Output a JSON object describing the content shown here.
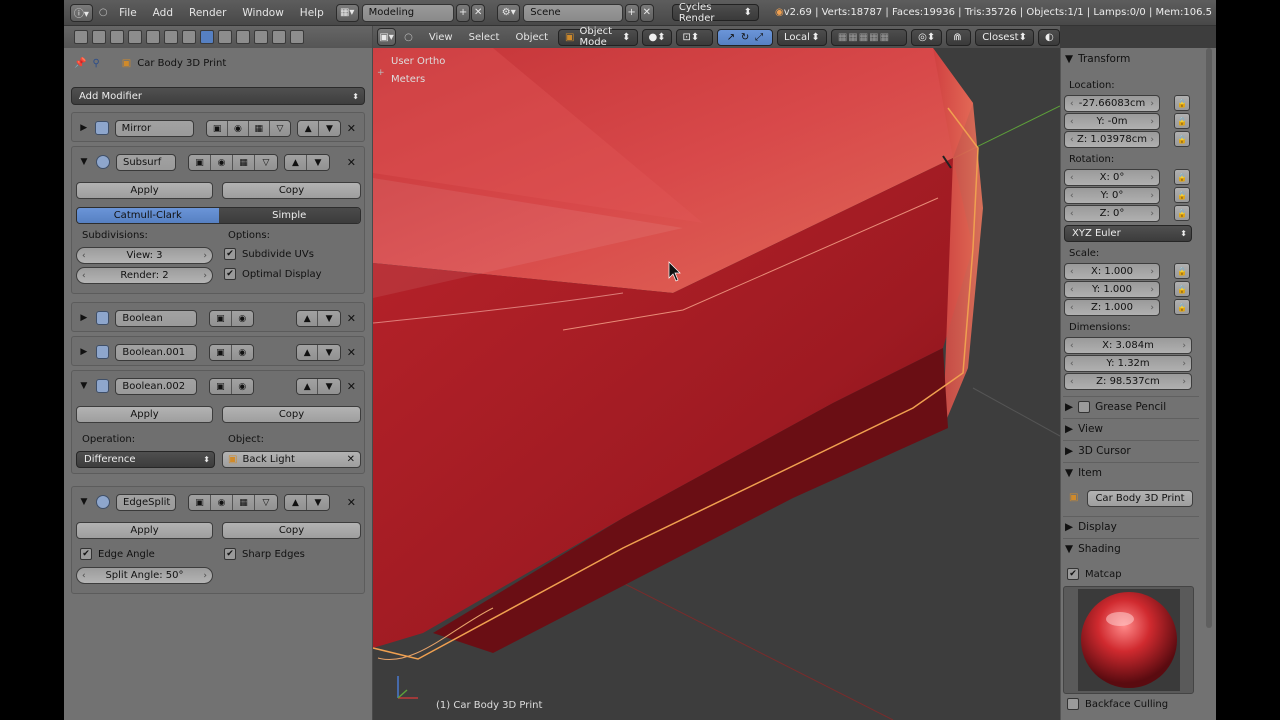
{
  "info_header": {
    "menus": [
      "File",
      "Add",
      "Render",
      "Window",
      "Help"
    ],
    "screen_layout": "Modeling",
    "scene": "Scene",
    "engine": "Cycles Render",
    "stats": "v2.69 | Verts:18787 | Faces:19936 | Tris:35726 | Objects:1/1 | Lamps:0/0 | Mem:106.5"
  },
  "props": {
    "object_name": "Car Body 3D Print",
    "add_modifier": "Add Modifier",
    "apply": "Apply",
    "copy": "Copy",
    "mirror": {
      "name": "Mirror"
    },
    "subsurf": {
      "name": "Subsurf",
      "mode_a": "Catmull-Clark",
      "mode_b": "Simple",
      "subdivisions_label": "Subdivisions:",
      "options_label": "Options:",
      "view": "View: 3",
      "render": "Render: 2",
      "subdivide_uvs": "Subdivide UVs",
      "optimal_display": "Optimal Display"
    },
    "boolean": {
      "name": "Boolean"
    },
    "boolean001": {
      "name": "Boolean.001"
    },
    "boolean002": {
      "name": "Boolean.002",
      "operation_label": "Operation:",
      "object_label": "Object:",
      "operation": "Difference",
      "object": "Back Light"
    },
    "edgesplit": {
      "name": "EdgeSplit",
      "edge_angle": "Edge Angle",
      "sharp_edges": "Sharp Edges",
      "split_angle": "Split Angle: 50°"
    }
  },
  "viewport": {
    "menus": [
      "View",
      "Select",
      "Object"
    ],
    "mode": "Object Mode",
    "orientation": "Local",
    "snap": "Closest",
    "view_label": "User Ortho",
    "units": "Meters",
    "footer": "(1) Car Body 3D Print"
  },
  "npanel": {
    "transform": "Transform",
    "location_label": "Location:",
    "loc_x": "-27.66083cm",
    "loc_y": "Y: -0m",
    "loc_z": "Z: 1.03978cm",
    "rotation_label": "Rotation:",
    "rot_x": "X: 0°",
    "rot_y": "Y: 0°",
    "rot_z": "Z: 0°",
    "rotation_mode": "XYZ Euler",
    "scale_label": "Scale:",
    "scale_x": "X: 1.000",
    "scale_y": "Y: 1.000",
    "scale_z": "Z: 1.000",
    "dimensions_label": "Dimensions:",
    "dim_x": "X: 3.084m",
    "dim_y": "Y: 1.32m",
    "dim_z": "Z: 98.537cm",
    "grease_pencil": "Grease Pencil",
    "view": "View",
    "cursor": "3D Cursor",
    "item": "Item",
    "item_name": "Car Body 3D Print",
    "display": "Display",
    "shading": "Shading",
    "matcap": "Matcap",
    "backface_culling": "Backface Culling"
  },
  "colors": {
    "accent_blue": "#5680c2",
    "selection_outline": "#f0a050",
    "model_red": "#c8282c",
    "background": "#727272"
  }
}
